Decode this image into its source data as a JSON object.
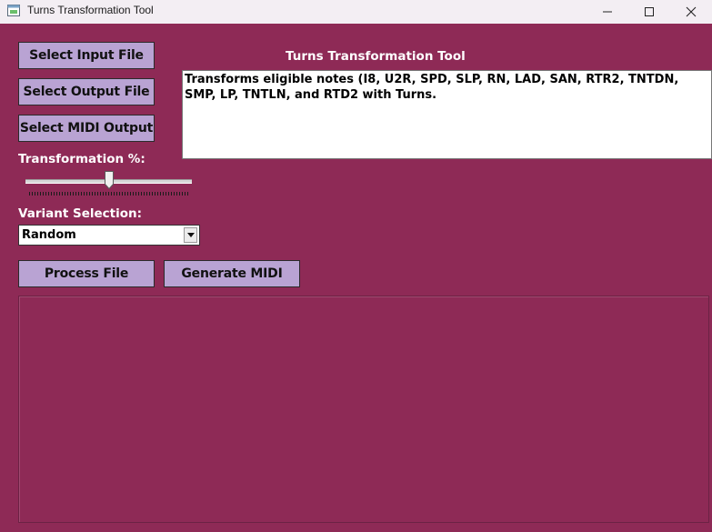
{
  "window": {
    "title": "Turns Transformation Tool",
    "bg_color": "#8e2a56",
    "controls": {
      "minimize": "minimize-icon",
      "maximize": "maximize-icon",
      "close": "close-icon"
    }
  },
  "buttons": {
    "select_input": "Select Input File",
    "select_output": "Select Output File",
    "select_midi": "Select MIDI Output",
    "process": "Process File",
    "generate_midi": "Generate MIDI",
    "color": "#b9a3d3"
  },
  "header": {
    "title": "Turns Transformation Tool"
  },
  "description": "Transforms eligible notes (I8, U2R, SPD, SLP, RN, LAD, SAN, RTR2, TNTDN, SMP, LP, TNTLN, and RTD2 with Turns.",
  "transformation": {
    "label": "Transformation %:",
    "value_fraction": 0.5
  },
  "variant": {
    "label": "Variant Selection:",
    "selected": "Random"
  },
  "output_log": {
    "text": ""
  }
}
